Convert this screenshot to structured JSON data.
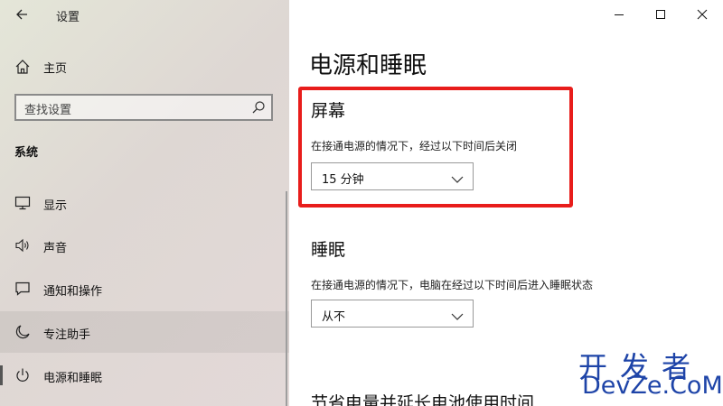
{
  "window": {
    "title": "设置"
  },
  "sidebar": {
    "home_label": "主页",
    "search_placeholder": "查找设置",
    "section_label": "系统",
    "items": [
      {
        "label": "显示",
        "icon": "monitor-icon"
      },
      {
        "label": "声音",
        "icon": "speaker-icon"
      },
      {
        "label": "通知和操作",
        "icon": "notification-icon"
      },
      {
        "label": "专注助手",
        "icon": "moon-icon"
      },
      {
        "label": "电源和睡眠",
        "icon": "power-icon"
      }
    ]
  },
  "main": {
    "page_title": "电源和睡眠",
    "screen": {
      "title": "屏幕",
      "desc": "在接通电源的情况下，经过以下时间后关闭",
      "value": "15 分钟"
    },
    "sleep": {
      "title": "睡眠",
      "desc": "在接通电源的情况下，电脑在经过以下时间后进入睡眠状态",
      "value": "从不"
    },
    "battery_heading_partial": "节省电量并延长电池使用时间"
  },
  "watermark": {
    "cn": "开发者",
    "en": "DevZe.CoM"
  },
  "colors": {
    "highlight_frame": "#e81d1b",
    "watermark": "#1e44a8"
  }
}
